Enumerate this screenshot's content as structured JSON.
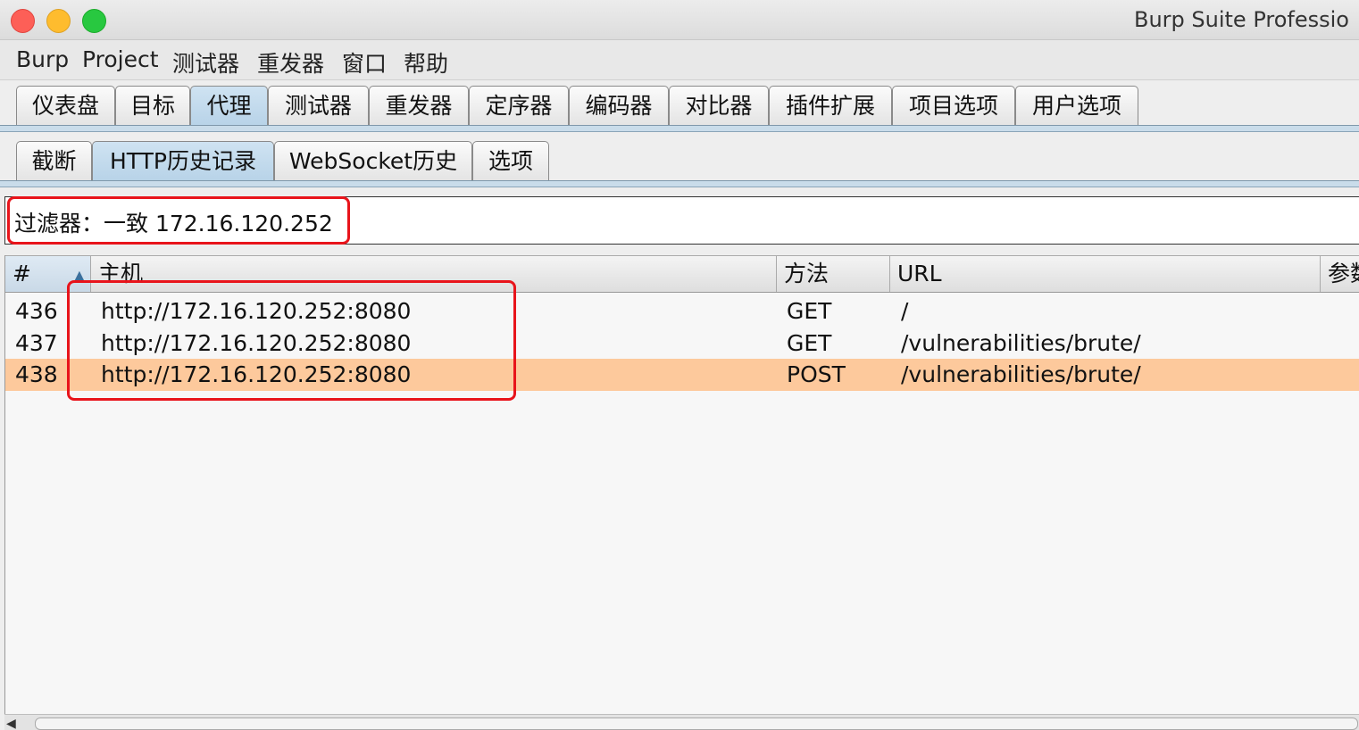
{
  "window": {
    "title": "Burp Suite Professio"
  },
  "menu": [
    "Burp",
    "Project",
    "测试器",
    "重发器",
    "窗口",
    "帮助"
  ],
  "main_tabs": [
    "仪表盘",
    "目标",
    "代理",
    "测试器",
    "重发器",
    "定序器",
    "编码器",
    "对比器",
    "插件扩展",
    "项目选项",
    "用户选项"
  ],
  "main_tabs_active": "代理",
  "sub_tabs": [
    "截断",
    "HTTP历史记录",
    "WebSocket历史",
    "选项"
  ],
  "sub_tabs_active": "HTTP历史记录",
  "filter": {
    "text": "过滤器：一致 172.16.120.252"
  },
  "table": {
    "columns": [
      "#",
      "主机",
      "方法",
      "URL",
      "参数"
    ],
    "sorted_column": "#",
    "sort_icon": "sort-ascending-icon",
    "rows": [
      {
        "num": "436",
        "host": "http://172.16.120.252:8080",
        "method": "GET",
        "url": "/"
      },
      {
        "num": "437",
        "host": "http://172.16.120.252:8080",
        "method": "GET",
        "url": "/vulnerabilities/brute/"
      },
      {
        "num": "438",
        "host": "http://172.16.120.252:8080",
        "method": "POST",
        "url": "/vulnerabilities/brute/"
      }
    ],
    "selected_row": "438"
  },
  "colors": {
    "selected_row": "#fdc99c",
    "highlight_box": "#e8141b",
    "active_tab": "#c0d8ea"
  }
}
